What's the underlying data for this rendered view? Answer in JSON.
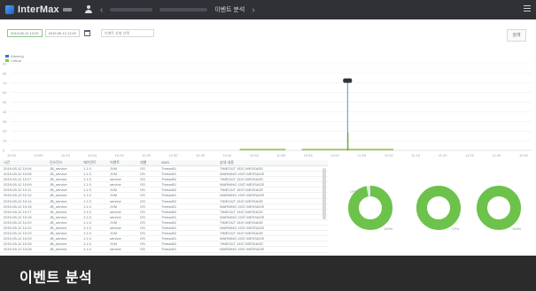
{
  "app": {
    "logo_text": "InterMax",
    "current_page": "이벤트 분석"
  },
  "filters": {
    "from_date": "2019-05-12 10:00",
    "to_date": "2019-05-12 11:00",
    "select_value": "이벤트 유형 선택",
    "search_label": "검색"
  },
  "chart_data": {
    "type": "line",
    "series": [
      {
        "name": "Warning",
        "color": "#2f7ab9"
      },
      {
        "name": "Critical",
        "color": "#8cc63f"
      }
    ],
    "x_ticks": [
      "10:00",
      "10:05",
      "10:10",
      "10:15",
      "10:20",
      "10:25",
      "10:30",
      "10:35",
      "10:40",
      "10:45",
      "10:50",
      "10:55",
      "11:00",
      "11:05",
      "11:10",
      "11:15",
      "11:20",
      "11:25",
      "11:30",
      "11:35"
    ],
    "y_ticks": [
      "0",
      "10",
      "20",
      "30",
      "40",
      "50",
      "60",
      "70",
      "80",
      "90"
    ],
    "spike": {
      "x_index": 12.5,
      "value": 72
    }
  },
  "table": {
    "columns": [
      "시간",
      "인스턴스",
      "에이전트",
      "이벤트",
      "레벨",
      "WAS",
      "상세 내용"
    ],
    "rows": [
      [
        "2019-05-12 10:04",
        "JB_service",
        "1.1.0",
        "JVM",
        "OS",
        "Thread01",
        "TIMEOUT 1537-MESSAGE ..."
      ],
      [
        "2019-05-12 10:06",
        "JB_service",
        "1.1.0",
        "JVM",
        "OS",
        "Thread01",
        "WARNING 1537-MESSAGE ..."
      ],
      [
        "2019-05-12 10:07",
        "JB_service",
        "1.1.0",
        "service",
        "OS",
        "Thread02",
        "TIMEOUT 1537-MESSAGE ..."
      ],
      [
        "2019-05-12 10:09",
        "JB_service",
        "1.1.0",
        "service",
        "OS",
        "Thread01",
        "WARNING 1537-MESSAGE ..."
      ],
      [
        "2019-05-12 10:11",
        "JB_service",
        "1.1.0",
        "JVM",
        "OS",
        "Thread02",
        "TIMEOUT 1537-MESSAGE ..."
      ],
      [
        "2019-05-12 10:12",
        "JB_service",
        "1.1.0",
        "JVM",
        "OS",
        "Thread01",
        "WARNING 1537-MESSAGE ..."
      ],
      [
        "2019-05-12 10:14",
        "JB_service",
        "1.1.0",
        "service",
        "OS",
        "Thread02",
        "TIMEOUT 1537-MESSAGE ..."
      ],
      [
        "2019-05-12 10:15",
        "JB_service",
        "1.1.0",
        "JVM",
        "OS",
        "Thread01",
        "WARNING 1537-MESSAGE ..."
      ],
      [
        "2019-05-12 10:17",
        "JB_service",
        "1.1.0",
        "service",
        "OS",
        "Thread02",
        "TIMEOUT 1537-MESSAGE ..."
      ],
      [
        "2019-05-12 10:18",
        "JB_service",
        "1.1.0",
        "service",
        "OS",
        "Thread01",
        "WARNING 1537-MESSAGE ..."
      ],
      [
        "2019-05-12 10:20",
        "JB_service",
        "1.1.0",
        "JVM",
        "OS",
        "Thread02",
        "TIMEOUT 1537-MESSAGE ..."
      ],
      [
        "2019-05-12 10:22",
        "JB_service",
        "1.1.0",
        "service",
        "OS",
        "Thread01",
        "WARNING 1537-MESSAGE ..."
      ],
      [
        "2019-05-12 10:23",
        "JB_service",
        "1.1.0",
        "JVM",
        "OS",
        "Thread02",
        "TIMEOUT 1537-MESSAGE ..."
      ],
      [
        "2019-05-12 10:25",
        "JB_service",
        "1.1.0",
        "service",
        "OS",
        "Thread01",
        "WARNING 1537-MESSAGE ..."
      ],
      [
        "2019-05-12 10:26",
        "JB_service",
        "1.1.0",
        "JVM",
        "OS",
        "Thread02",
        "TIMEOUT 1537-MESSAGE ..."
      ],
      [
        "2019-05-12 10:28",
        "JB_service",
        "1.1.0",
        "service",
        "OS",
        "Thread01",
        "WARNING 1537-MESSAGE ..."
      ]
    ]
  },
  "donuts": [
    {
      "label_top": "CPU",
      "label_bottom": "100%",
      "fraction": 0.97
    },
    {
      "label_top": "",
      "label_bottom": "CPU",
      "fraction": 1.0
    },
    {
      "label_top": "",
      "label_bottom": "100%",
      "fraction": 1.0
    }
  ],
  "colors": {
    "topbar": "#2f3136",
    "accent_green": "#6cc24a",
    "accent_blue": "#2f7ab9"
  },
  "caption": {
    "text": "이벤트 분석"
  }
}
